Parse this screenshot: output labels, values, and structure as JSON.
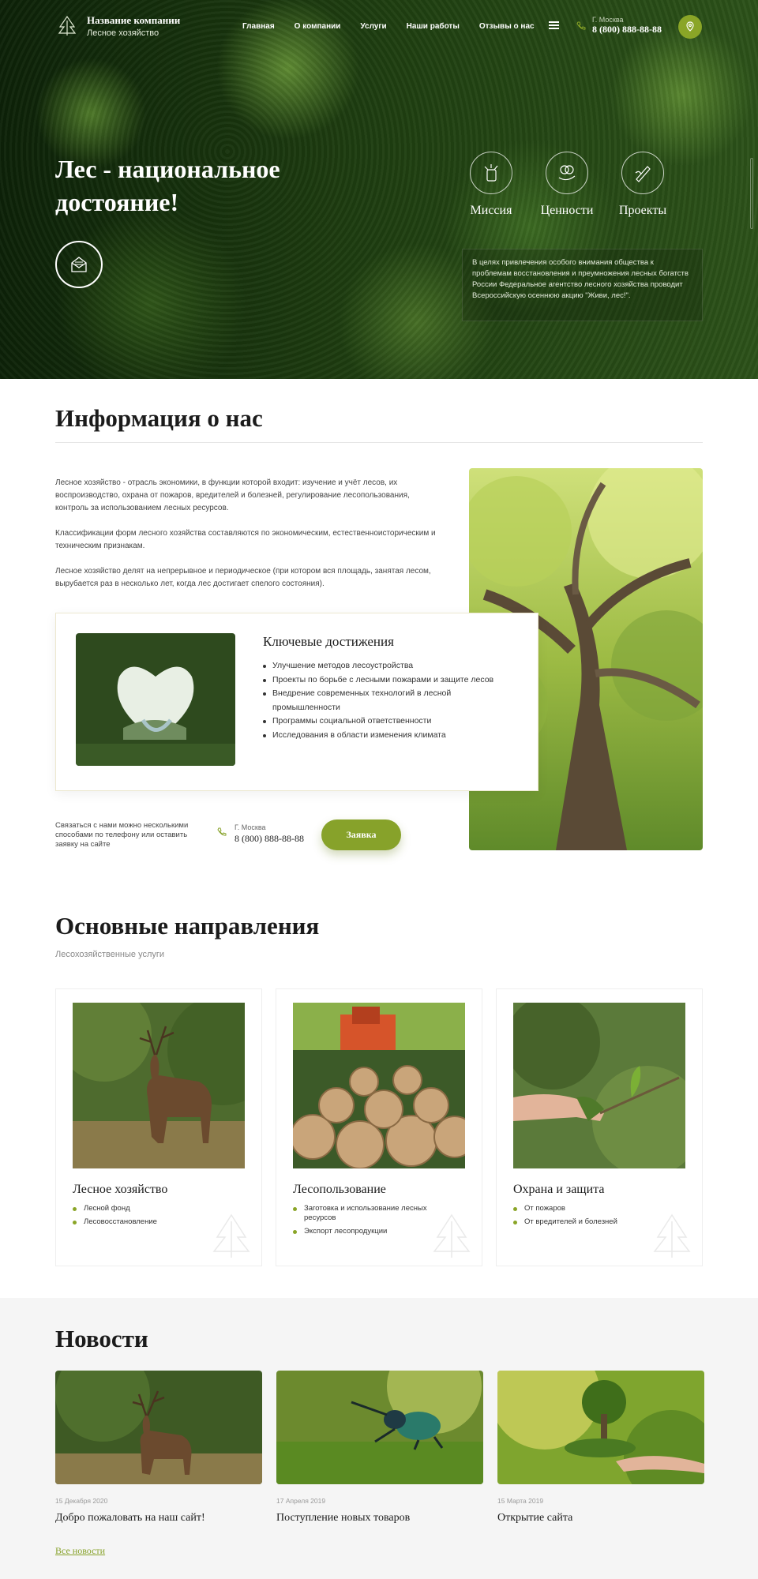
{
  "header": {
    "company_name": "Название компании",
    "company_sub": "Лесное хозяйство",
    "nav": [
      "Главная",
      "О компании",
      "Услуги",
      "Наши работы",
      "Отзывы о нас"
    ],
    "city": "Г. Москва",
    "phone": "8 (800) 888-88-88"
  },
  "hero": {
    "title": "Лес - национальное достояние!",
    "features": [
      {
        "label": "Миссия",
        "icon": "mission-icon"
      },
      {
        "label": "Ценности",
        "icon": "values-icon"
      },
      {
        "label": "Проекты",
        "icon": "projects-icon"
      }
    ],
    "note": "В целях привлечения особого внимания общества к проблемам восстановления и преумножения лесных богатств России Федеральное агентство лесного хозяйства проводит Всероссийскую осеннюю акцию \"Живи, лес!\"."
  },
  "about": {
    "title": "Информация о нас",
    "paragraphs": [
      "Лесное хозяйство - отрасль экономики, в функции которой входит: изучение и учёт лесов, их воспроизводство, охрана от пожаров, вредителей и болезней, регулирование лесопользования, контроль за использованием лесных ресурсов.",
      "Классификации форм лесного хозяйства составляются по экономическим, естественноисторическим и техническим признакам.",
      "Лесное хозяйство делят на непрерывное и периодическое (при котором вся площадь, занятая лесом, вырубается раз в несколько лет, когда лес достигает спелого состояния)."
    ],
    "achievements_title": "Ключевые достижения",
    "achievements": [
      "Улучшение методов лесоустройства",
      "Проекты по борьбе с лесными пожарами и защите лесов",
      "Внедрение современных технологий в лесной промышленности",
      "Программы социальной ответственности",
      "Исследования в области изменения климата"
    ],
    "contact_text": "Связаться с нами можно несколькими способами по телефону  или оставить заявку на сайте",
    "city": "Г. Москва",
    "phone": "8 (800) 888-88-88",
    "request_button": "Заявка"
  },
  "directions": {
    "title": "Основные направления",
    "subtitle": "Лесохозяйственные услуги",
    "cards": [
      {
        "title": "Лесное хозяйство",
        "items": [
          "Лесной фонд",
          "Лесовосстановление"
        ]
      },
      {
        "title": "Лесопользование",
        "items": [
          "Заготовка и использование лесных ресурсов",
          "Экспорт лесопродукции"
        ]
      },
      {
        "title": "Охрана и защита",
        "items": [
          "От пожаров",
          "От вредителей и болезней"
        ]
      }
    ]
  },
  "news": {
    "title": "Новости",
    "items": [
      {
        "date": "15 Декабря 2020",
        "headline": "Добро пожаловать на наш сайт!"
      },
      {
        "date": "17 Апреля 2019",
        "headline": "Поступление новых товаров"
      },
      {
        "date": "15 Марта 2019",
        "headline": "Открытие сайта"
      }
    ],
    "all_link": "Все новости"
  },
  "colors": {
    "accent": "#87a22a",
    "hero_dark": "#1d3c10"
  }
}
